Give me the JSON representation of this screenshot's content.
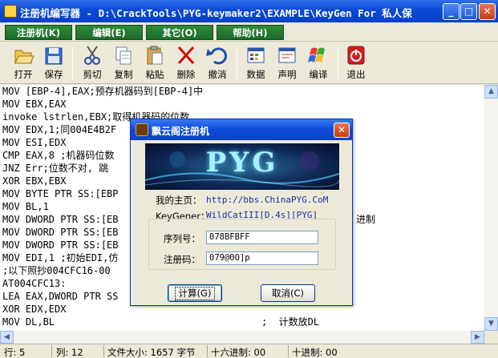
{
  "window": {
    "title": "注册机编写器 - D:\\CrackTools\\PYG-keymaker2\\EXAMPLE\\KeyGen For 私人保",
    "controls": {
      "minimize": "_",
      "maximize": "□",
      "close": "✕"
    }
  },
  "menu": [
    {
      "label": "注册机(K)",
      "icon": ""
    },
    {
      "label": "编辑(E)"
    },
    {
      "label": "其它(O)"
    },
    {
      "label": "帮助(H)"
    }
  ],
  "toolbar": [
    {
      "label": "打开",
      "icon": "open-folder-icon"
    },
    {
      "label": "保存",
      "icon": "floppy-disk-icon"
    },
    {
      "label": "剪切",
      "icon": "scissors-icon"
    },
    {
      "label": "复制",
      "icon": "copy-icon"
    },
    {
      "label": "粘贴",
      "icon": "paste-icon"
    },
    {
      "label": "删除",
      "icon": "delete-x-icon"
    },
    {
      "label": "撤消",
      "icon": "undo-icon"
    },
    {
      "label": "数据",
      "icon": "data-grid-icon"
    },
    {
      "label": "声明",
      "icon": "declare-form-icon"
    },
    {
      "label": "编译",
      "icon": "compile-flag-icon"
    },
    {
      "label": "退出",
      "icon": "power-exit-icon"
    }
  ],
  "editor": {
    "lines": [
      "MOV [EBP-4],EAX;预存机器码到[EBP-4]中",
      "MOV EBX,EAX",
      "invoke lstrlen,EBX;取得机器码的位数",
      "MOV EDX,1;同004E4B2F",
      "MOV ESI,EDX",
      "CMP EAX,8 ;机器码位数",
      "JNZ Err;位数不对, 跳",
      "XOR EBX,EBX",
      "MOV BYTE PTR SS:[EBP",
      "MOV BL,1",
      "MOV DWORD PTR SS:[EB",
      "MOV DWORD PTR SS:[EB",
      "MOV DWORD PTR SS:[EB",
      "MOV EDI,1 ;初始EDI,仿",
      ";以下照抄004CFC16-00",
      "AT004CFC13:",
      "LEA EAX,DWORD PTR SS",
      "XOR EDX,EDX",
      "MOV DL,BL"
    ],
    "right_fragments": [
      {
        "line": 11,
        "text": "进制"
      },
      {
        "line": 18,
        "text": ";  计数放DL"
      }
    ]
  },
  "statusbar": {
    "row": "行: 5",
    "col": "列: 12",
    "filesize": "文件大小: 1657 字节",
    "hex": "十六进制: 00",
    "dec": "十进制: 00"
  },
  "dialog": {
    "title": "飘云阁注册机",
    "close": "✕",
    "banner_text": "PYG",
    "homepage_label": "我的主页：",
    "homepage_url": "http://bbs.ChinaPYG.CoM",
    "keygener_label": "KeyGener：",
    "keygener_value": "WildCatIII[D.4s][PYG]",
    "serial_label": "序列号：",
    "serial_value": "078BFBFF",
    "regcode_label": "注册码：",
    "regcode_value": "079@0O]p",
    "calc_button": "计算(G)",
    "cancel_button": "取消(C)"
  },
  "colors": {
    "titlebar": "#0a4ad6",
    "menu_green": "#1c6b28",
    "link_blue": "#1a2ea8"
  }
}
